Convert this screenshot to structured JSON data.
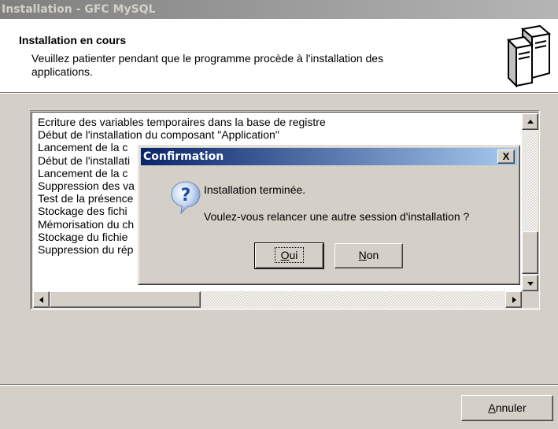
{
  "window": {
    "title": "Installation - GFC MySQL"
  },
  "header": {
    "title": "Installation en cours",
    "description": "Veuillez patienter pendant que le programme procède à l'installation des applications."
  },
  "log": {
    "lines": [
      "Ecriture des variables temporaires dans la base de registre",
      "Début de l'installation du composant \"Application\"",
      "Lancement de la c",
      "Début de l'installati",
      "Lancement de la c",
      "Suppression des va",
      "Test de la présence",
      "Stockage des fichi",
      "Mémorisation du ch",
      "Stockage du fichie",
      "Suppression du rép"
    ]
  },
  "footer": {
    "cancel_label": "Annuler",
    "cancel_mnemonic": "A",
    "cancel_rest": "nnuler"
  },
  "dialog": {
    "title": "Confirmation",
    "close_label": "X",
    "icon": "question-icon",
    "message_line1": "Installation terminée.",
    "message_line2": "Voulez-vous relancer une autre session d'installation ?",
    "yes_label": "Oui",
    "yes_mnemonic": "O",
    "yes_rest": "ui",
    "no_label": "Non",
    "no_mnemonic": "N",
    "no_rest": "on"
  }
}
